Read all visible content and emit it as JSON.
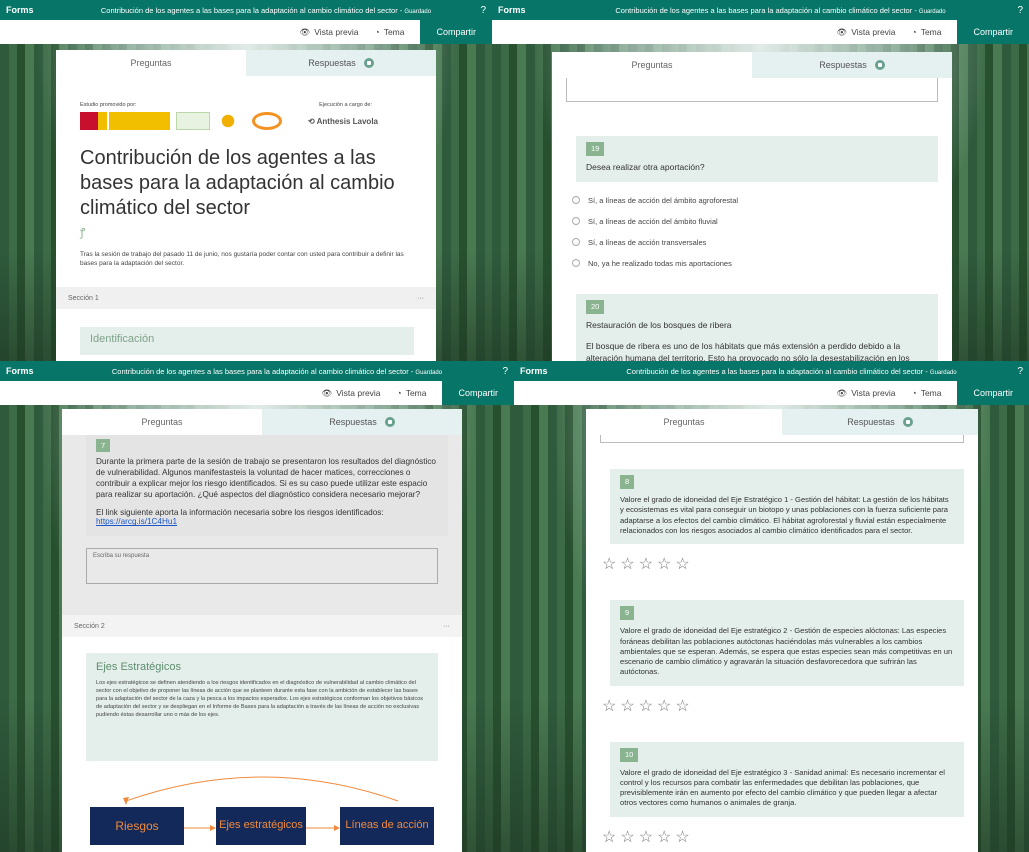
{
  "app_name": "Forms",
  "form_title": "Contribución de los agentes a las bases para la adaptación al cambio climático del sector",
  "saved_label": "Guardado",
  "help_label": "?",
  "toolbar": {
    "preview": "Vista previa",
    "theme": "Tema",
    "share": "Compartir"
  },
  "tabs": {
    "questions": "Preguntas",
    "responses": "Respuestas"
  },
  "panel1": {
    "promoted_by": "Estudio promovido por:",
    "executed_by": "Ejecución a cargo de:",
    "logo_company": "Anthesis Lavola",
    "big_title": "Contribución de los agentes a las bases para la adaptación al cambio climático del sector",
    "description": "Tras la sesión de trabajo del pasado 11 de junio, nos gustaría poder contar con usted para contribuir a definir las bases para la adaptación del sector.",
    "section_label": "Sección 1",
    "section_more": "···",
    "identification": "Identificación"
  },
  "panel2": {
    "q19_number": "19",
    "q19_text": "Desea realizar otra aportación?",
    "q19_options": [
      "Sí, a líneas de acción del ámbito agroforestal",
      "Sí, a líneas de acción del ámbito fluvial",
      "Sí, a líneas de acción transversales",
      "No, ya he realizado todas mis aportaciones"
    ],
    "q20_number": "20",
    "q20_title": "Restauración de los bosques de ribera",
    "q20_body": "El bosque de ribera es uno de los hábitats que más extensión a perdido debido a la alteración humana del territorio. Esto ha provocado no sólo la desestabilización en los márgenes de los"
  },
  "panel3": {
    "q7_number": "7",
    "q7_text": "Durante la primera parte de la sesión de trabajo se presentaron los resultados del diagnóstico de vulnerabilidad. Algunos manifestasteis la voluntad de hacer matices, correcciones o contribuir a explicar mejor los riesgo identificados. Si es su caso puede utilizar este espacio para realizar su aportación.  ¿Qué aspectos del diagnóstico considera necesario mejorar?",
    "q7_link_intro": "El link siguiente aporta la información necesaria sobre los riesgos identificados:",
    "q7_link": "https://arcg.is/1C4Hu1",
    "answer_placeholder": "Escriba su respuesta",
    "section_label": "Sección 2",
    "section_more": "···",
    "axes_title": "Ejes Estratégicos",
    "axes_text": "Los ejes estratégicos se definen atendiendo a los riesgos identificados en el diagnóstico de vulnerabilidad al cambio climático del sector con el objetivo de proponer las líneas de acción que se planteen durante esta fase con la ambición de establecer las bases para la adaptación del sector de la caza y la pesca a los impactos esperados. Los ejes estratégicos conforman los objetivos básicos de adaptación del sector y se despliegan en el Informe de Bases para la adaptación a través de las líneas de acción no exclusivas pudiendo éstas desarrollar uno o más de los ejes.",
    "diagram": {
      "box1": "Riesgos",
      "box2": "Ejes estratégicos",
      "box3": "Líneas de acción"
    }
  },
  "panel4": {
    "q8_number": "8",
    "q8_text": "Valore el grado de idoneidad del Eje Estratégico 1 - Gestión del hábitat: La gestión de los hábitats y ecosistemas es vital para conseguir un biotopo y unas poblaciones con la fuerza suficiente para adaptarse a los efectos del cambio climático. El hábitat agroforestal y fluvial están especialmente relacionados con los riesgos asociados al cambio climático identificados para el sector.",
    "q9_number": "9",
    "q9_text": "Valore el grado de idoneidad del Eje estratégico 2 - Gestión de especies alóctonas: Las especies foráneas debilitan las poblaciones autóctonas haciéndolas más vulnerables a los cambios ambientales que se esperan. Además, se espera que estas especies sean más competitivas en un escenario de cambio climático y agravarán la situación desfavorecedora que sufrirán las autóctonas.",
    "q10_number": "10",
    "q10_text": "Valore el grado de idoneidad del Eje estratégico 3 - Sanidad animal: Es necesario incrementar el control y los recursos para combatir las enfermedades que debilitan las poblaciones, que previsiblemente irán en aumento por efecto del cambio climático y que pueden llegar a afectar otros vectores como humanos o animales de granja.",
    "star_glyph": "☆"
  },
  "colors": {
    "brand": "#077568",
    "question_bg": "#e4eeea",
    "number_badge": "#8ab38f",
    "diagram_box": "#13295a",
    "diagram_text": "#f08a3c"
  }
}
